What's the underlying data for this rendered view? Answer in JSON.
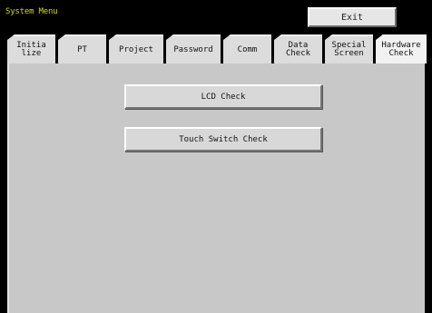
{
  "window": {
    "title": "System Menu",
    "exit_label": "Exit"
  },
  "tabs": [
    {
      "label": "Initia\nlize",
      "active": false
    },
    {
      "label": "PT",
      "active": false
    },
    {
      "label": "Project",
      "active": false
    },
    {
      "label": "Password",
      "active": false
    },
    {
      "label": "Comm",
      "active": false
    },
    {
      "label": "Data\nCheck",
      "active": false
    },
    {
      "label": "Special\nScreen",
      "active": false
    },
    {
      "label": "Hardware\nCheck",
      "active": true
    }
  ],
  "panel": {
    "buttons": [
      {
        "label": "LCD Check"
      },
      {
        "label": "Touch Switch Check"
      }
    ]
  },
  "colors": {
    "title_text": "#d8d800",
    "background": "#000000",
    "panel": "#c8c8c8"
  }
}
